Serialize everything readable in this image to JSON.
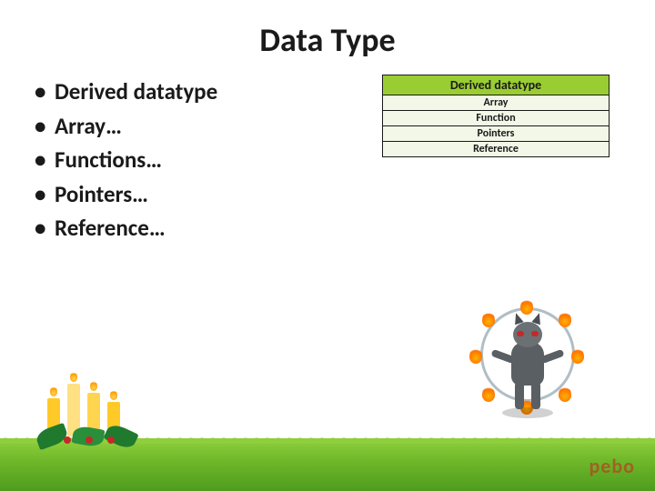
{
  "title": "Data Type",
  "bullets": [
    "Derived datatype",
    "Array…",
    "Functions…",
    "Pointers…",
    "Reference…"
  ],
  "table": {
    "header": "Derived datatype",
    "rows": [
      "Array",
      "Function",
      "Pointers",
      "Reference"
    ]
  },
  "watermark": "pebo"
}
